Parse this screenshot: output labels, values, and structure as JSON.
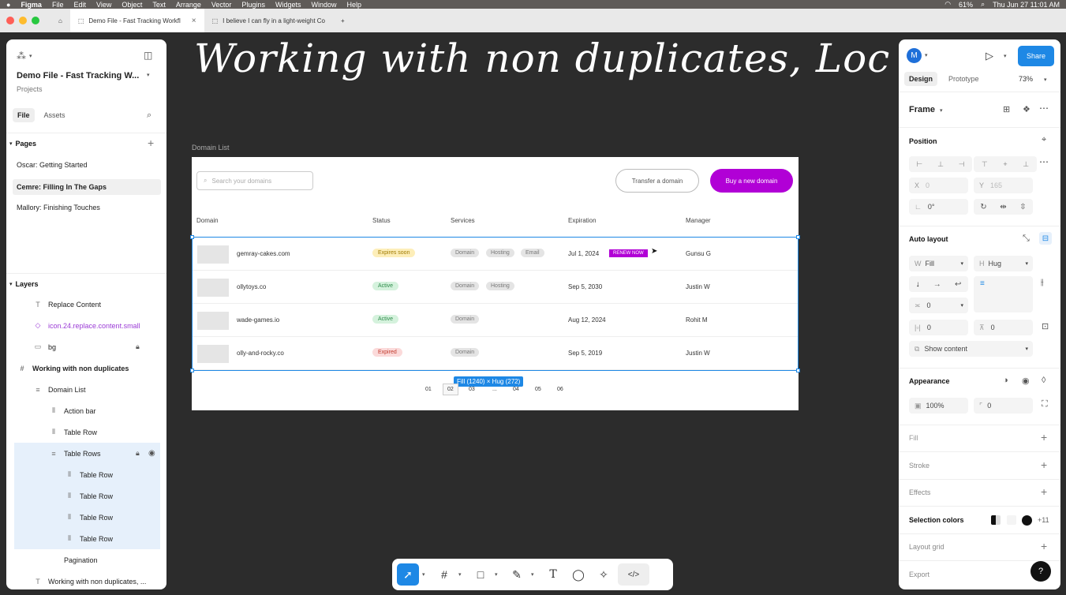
{
  "menubar": {
    "app": "Figma",
    "items": [
      "File",
      "Edit",
      "View",
      "Object",
      "Text",
      "Arrange",
      "Vector",
      "Plugins",
      "Widgets",
      "Window",
      "Help"
    ],
    "battery": "61%",
    "clock": "Thu Jun 27  11:01 AM"
  },
  "tabs": [
    {
      "label": "Demo File - Fast Tracking Workfl"
    },
    {
      "label": "I believe I can fly in a light-weight Co"
    }
  ],
  "overlay_text": "Working with non duplicates, Loc",
  "left": {
    "file_title": "Demo File - Fast Tracking W...",
    "file_sub": "Projects",
    "tab_file": "File",
    "tab_assets": "Assets",
    "pages_title": "Pages",
    "pages": [
      "Oscar: Getting Started",
      "Cemre: Filling In The Gaps",
      "Mallory: Finishing Touches"
    ],
    "layers_title": "Layers",
    "layers": [
      {
        "label": "Replace Content",
        "icon": "T"
      },
      {
        "label": "icon.24.replace.content.small",
        "icon": "◇"
      },
      {
        "label": "bg",
        "icon": "▭"
      },
      {
        "label": "Working with non duplicates",
        "icon": "#"
      },
      {
        "label": "Domain List",
        "icon": "≡"
      },
      {
        "label": "Action bar",
        "icon": "⫴"
      },
      {
        "label": "Table Row",
        "icon": "⫴"
      },
      {
        "label": "Table Rows",
        "icon": "≡"
      },
      {
        "label": "Table Row",
        "icon": "⫴"
      },
      {
        "label": "Table Row",
        "icon": "⫴"
      },
      {
        "label": "Table Row",
        "icon": "⫴"
      },
      {
        "label": "Table Row",
        "icon": "⫴"
      },
      {
        "label": "Pagination",
        "icon": ""
      },
      {
        "label": "Working with non duplicates, ...",
        "icon": "T"
      }
    ]
  },
  "frame": {
    "label": "Domain List",
    "search_placeholder": "Search your domains",
    "transfer_btn": "Transfer a domain",
    "buy_btn": "Buy a new domain",
    "headers": [
      "Domain",
      "Status",
      "Services",
      "Expiration",
      "Manager"
    ],
    "rows": [
      {
        "domain": "gemray-cakes.com",
        "status": "Expires soon",
        "services": [
          "Domain",
          "Hosting",
          "Email"
        ],
        "expiration": "Jul 1, 2024",
        "renew": "RENEW NOW",
        "manager": "Gunsu G"
      },
      {
        "domain": "ollytoys.co",
        "status": "Active",
        "services": [
          "Domain",
          "Hosting"
        ],
        "expiration": "Sep 5, 2030",
        "manager": "Justin W"
      },
      {
        "domain": "wade-games.io",
        "status": "Active",
        "services": [
          "Domain"
        ],
        "expiration": "Aug 12, 2024",
        "manager": "Rohit M"
      },
      {
        "domain": "olly-and-rocky.co",
        "status": "Expired",
        "services": [
          "Domain"
        ],
        "expiration": "Sep 5, 2019",
        "manager": "Justin W"
      }
    ],
    "size_label": "Fill (1240) × Hug (272)",
    "pages": [
      "01",
      "02",
      "03",
      "...",
      "04",
      "05",
      "06"
    ]
  },
  "right": {
    "avatar": "M",
    "share": "Share",
    "tab_design": "Design",
    "tab_prototype": "Prototype",
    "zoom": "73%",
    "frame_label": "Frame",
    "position_title": "Position",
    "x": "0",
    "y": "165",
    "rotation": "0°",
    "x_label": "X",
    "y_label": "Y",
    "autolayout_title": "Auto layout",
    "w_label": "W",
    "w_value": "Fill",
    "h_label": "H",
    "h_value": "Hug",
    "gap": "0",
    "pad_h": "0",
    "pad_v": "0",
    "show_content": "Show content",
    "appearance_title": "Appearance",
    "opacity": "100%",
    "radius": "0",
    "fill": "Fill",
    "stroke": "Stroke",
    "effects": "Effects",
    "selection_colors": "Selection colors",
    "sel_more": "+11",
    "layout_grid": "Layout grid",
    "export": "Export",
    "help": "?"
  },
  "colors": {
    "accent": "#1e88e5",
    "brand": "#b100d6"
  }
}
